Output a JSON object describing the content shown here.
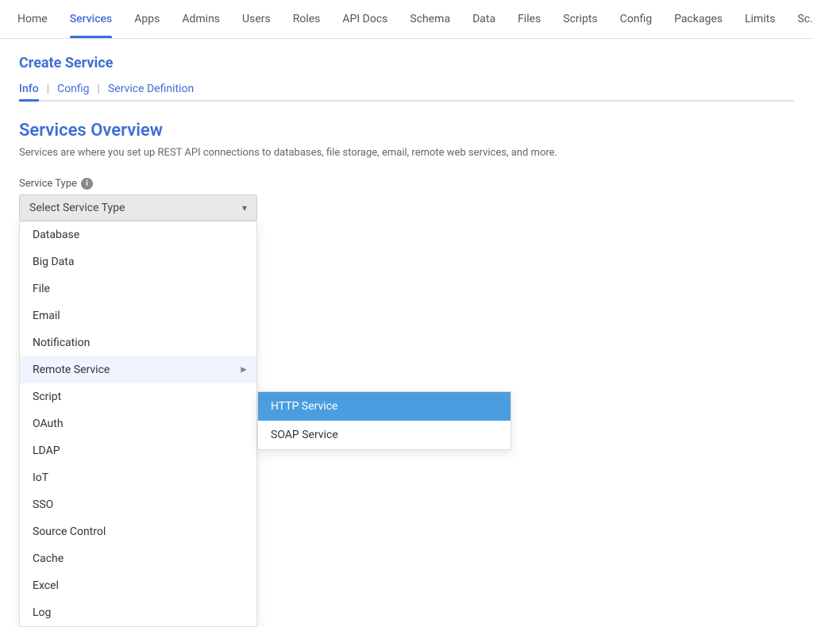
{
  "nav": {
    "items": [
      {
        "label": "Home",
        "active": false
      },
      {
        "label": "Services",
        "active": true
      },
      {
        "label": "Apps",
        "active": false
      },
      {
        "label": "Admins",
        "active": false
      },
      {
        "label": "Users",
        "active": false
      },
      {
        "label": "Roles",
        "active": false
      },
      {
        "label": "API Docs",
        "active": false
      },
      {
        "label": "Schema",
        "active": false
      },
      {
        "label": "Data",
        "active": false
      },
      {
        "label": "Files",
        "active": false
      },
      {
        "label": "Scripts",
        "active": false
      },
      {
        "label": "Config",
        "active": false
      },
      {
        "label": "Packages",
        "active": false
      },
      {
        "label": "Limits",
        "active": false
      },
      {
        "label": "Sc...",
        "active": false
      }
    ]
  },
  "page_title": "Create Service",
  "sub_tabs": [
    {
      "label": "Info",
      "active": true
    },
    {
      "label": "Config",
      "active": false
    },
    {
      "label": "Service Definition",
      "active": false
    }
  ],
  "section_title": "Services Overview",
  "section_desc": "Services are where you set up REST API connections to databases, file storage, email, remote web services, and more.",
  "service_type_label": "Service Type",
  "dropdown_placeholder": "Select Service Type",
  "dropdown_items": [
    {
      "label": "Database",
      "has_submenu": false
    },
    {
      "label": "Big Data",
      "has_submenu": false
    },
    {
      "label": "File",
      "has_submenu": false
    },
    {
      "label": "Email",
      "has_submenu": false
    },
    {
      "label": "Notification",
      "has_submenu": false
    },
    {
      "label": "Remote Service",
      "has_submenu": true,
      "active_sub": true
    },
    {
      "label": "Script",
      "has_submenu": false
    },
    {
      "label": "OAuth",
      "has_submenu": false
    },
    {
      "label": "LDAP",
      "has_submenu": false
    },
    {
      "label": "IoT",
      "has_submenu": false
    },
    {
      "label": "SSO",
      "has_submenu": false
    },
    {
      "label": "Source Control",
      "has_submenu": false
    },
    {
      "label": "Cache",
      "has_submenu": false
    },
    {
      "label": "Excel",
      "has_submenu": false
    },
    {
      "label": "Log",
      "has_submenu": false
    }
  ],
  "submenu_items": [
    {
      "label": "HTTP Service",
      "highlighted": true
    },
    {
      "label": "SOAP Service",
      "highlighted": false
    }
  ],
  "icons": {
    "info": "i",
    "chevron_down": "▾",
    "chevron_right": "▶"
  }
}
